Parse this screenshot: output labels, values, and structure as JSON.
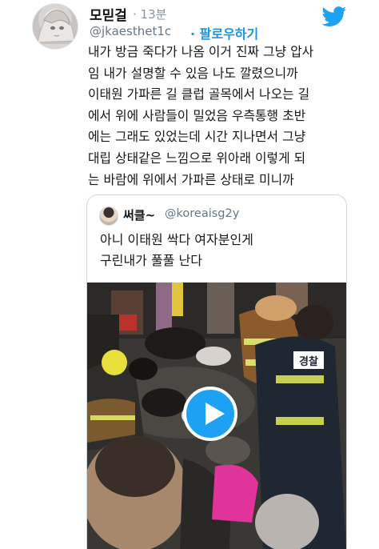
{
  "tweet": {
    "author_name": "모믿걸",
    "time": "· 13분",
    "handle": "@jkaesthet1c",
    "follow_label": "· 팔로우하기",
    "text": "내가 방금 죽다가 나옴 이거 진짜 그냥 압사\n임 내가 설명할 수 있음 나도 깔렸으니까\n이태원 가파른 길 클럽 골목에서 나오는 길\n에서 위에 사람들이 밀었음 우측통행 초반\n에는 그래도 있었는데 시간 지나면서 그냥\n대립 상태같은 느낌으로 위아래 이렇게 되\n는 바람에 위에서 가파른 상태로 미니까",
    "brand_icon": "twitter-bird-icon",
    "accent_color": "#1da1f2"
  },
  "quoted": {
    "author_name": "써클~",
    "handle": "@koreaisg2y",
    "text": "아니 이태원 싹다 여자분인게\n구린내가 풀풀 난다",
    "media_type": "video",
    "play_icon": "play-icon",
    "vest_text": "경찰"
  }
}
